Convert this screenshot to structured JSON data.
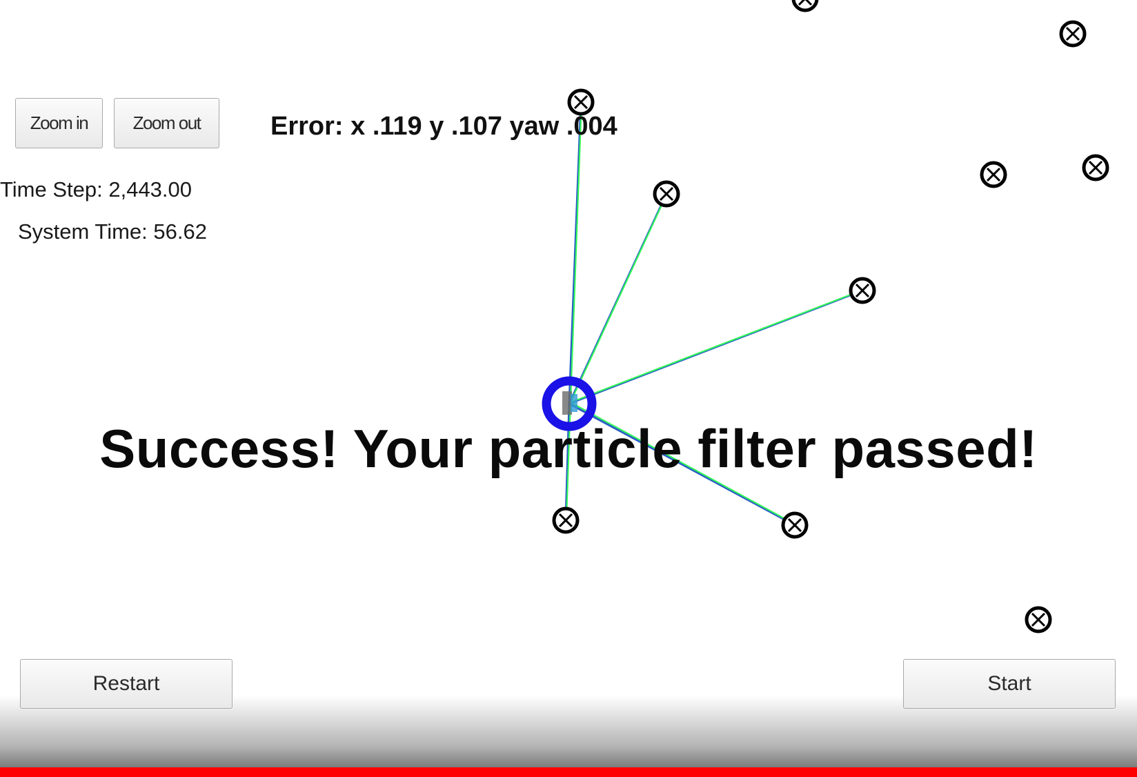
{
  "controls": {
    "zoom_in_label": "Zoom in",
    "zoom_out_label": "Zoom out",
    "restart_label": "Restart",
    "start_label": "Start"
  },
  "hud": {
    "time_step": "Time Step: 2,443.00",
    "system_time": "System Time: 56.62",
    "error": "Error: x .119 y .107 yaw .004"
  },
  "status": {
    "message": "Success! Your particle filter passed!"
  },
  "video_progress": {
    "fraction": 1.0
  },
  "colors": {
    "vehicle_ring": "#1a12e6",
    "ground_truth_line": "#33ff55",
    "estimate_line": "#2a5fc4",
    "landmark": "#000000",
    "accent": "#ff0000"
  },
  "icons": {
    "landmark": "circled-x-icon",
    "vehicle": "vehicle-marker-icon"
  }
}
